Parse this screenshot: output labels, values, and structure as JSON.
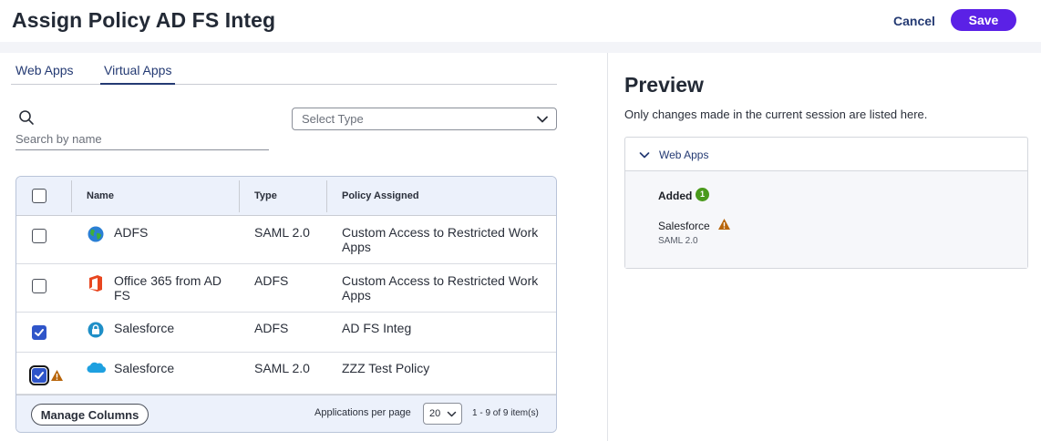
{
  "header": {
    "title": "Assign Policy AD FS Integ",
    "cancel_label": "Cancel",
    "save_label": "Save",
    "accent": "#5b21e6"
  },
  "tabs": [
    {
      "label": "Web Apps",
      "active": false
    },
    {
      "label": "Virtual Apps",
      "active": true
    }
  ],
  "search": {
    "placeholder": "Search by name",
    "value": ""
  },
  "type_filter": {
    "placeholder": "Select Type"
  },
  "table": {
    "columns": [
      "Name",
      "Type",
      "Policy Assigned"
    ],
    "rows": [
      {
        "checked": false,
        "icon": "globe-icon",
        "name": "ADFS",
        "type": "SAML 2.0",
        "policy": "Custom Access to Restricted Work Apps",
        "warning": false
      },
      {
        "checked": false,
        "icon": "office-365-icon",
        "name": "Office 365 from AD FS",
        "type": "ADFS",
        "policy": "Custom Access to Restricted Work Apps",
        "warning": false
      },
      {
        "checked": true,
        "icon": "lock-badge-icon",
        "name": "Salesforce",
        "type": "ADFS",
        "policy": "AD FS Integ",
        "warning": false
      },
      {
        "checked": true,
        "icon": "salesforce-cloud-icon",
        "name": "Salesforce",
        "type": "SAML 2.0",
        "policy": "ZZZ Test Policy",
        "warning": true
      }
    ],
    "footer": {
      "manage_label": "Manage Columns",
      "per_page_label": "Applications per page",
      "per_page_value": "20",
      "range_text": "1 - 9 of 9 item(s)"
    }
  },
  "preview": {
    "title": "Preview",
    "note": "Only changes made in the current session are listed here.",
    "section_label": "Web Apps",
    "added_label": "Added",
    "added_count": "1",
    "item_name": "Salesforce",
    "item_type": "SAML 2.0",
    "warning_color": "#b8650a"
  }
}
